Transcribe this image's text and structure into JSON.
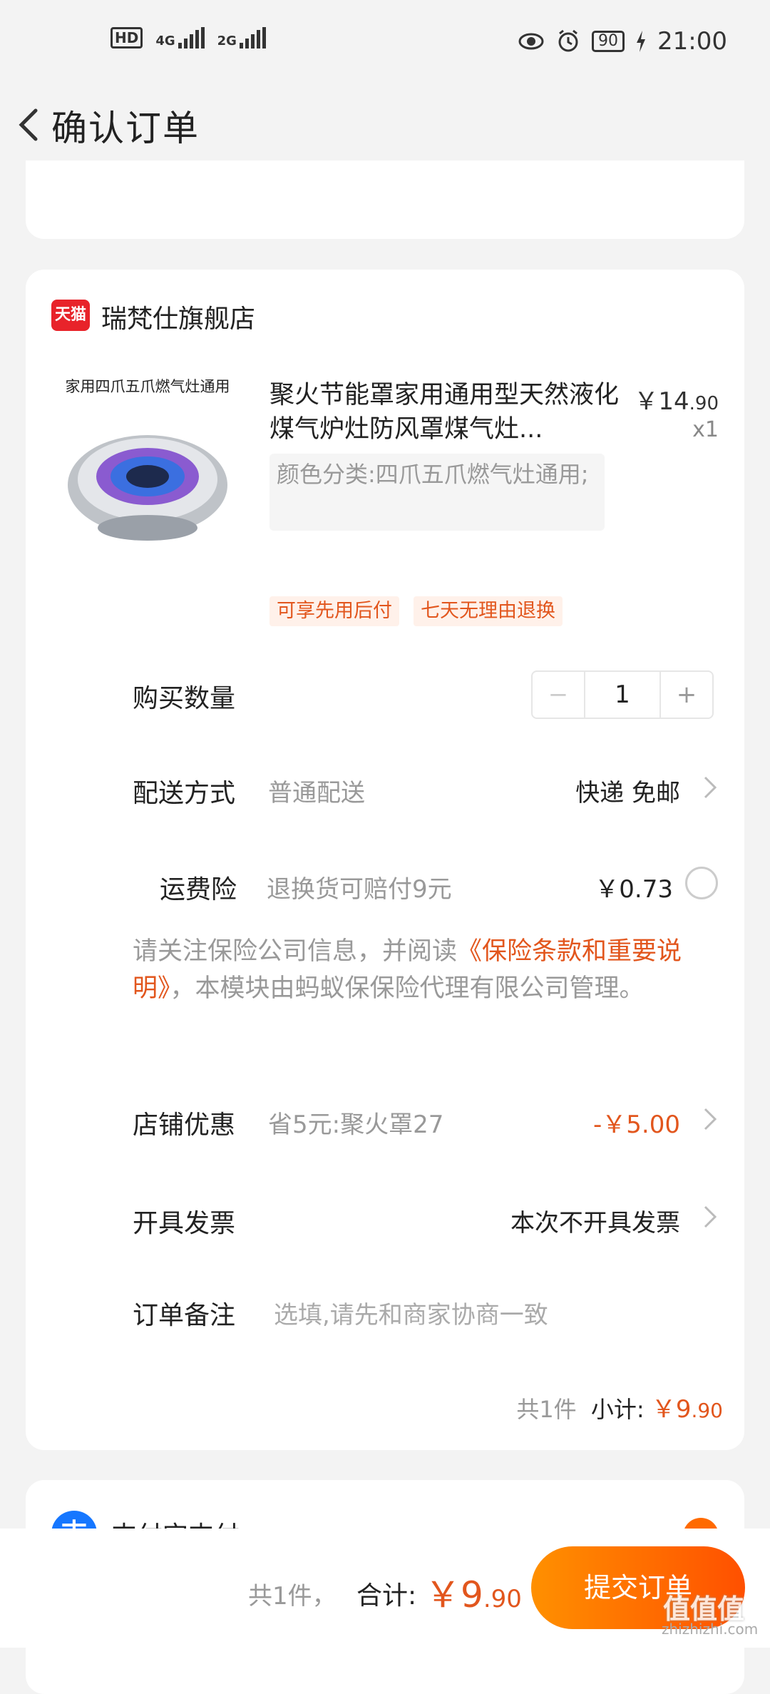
{
  "status_bar": {
    "hd": "HD",
    "sim1_net": "4G",
    "sim2_net": "2G",
    "battery": "90",
    "time": "21:00"
  },
  "header": {
    "title": "确认订单"
  },
  "shop": {
    "badge": "天猫",
    "name": "瑞梵仕旗舰店"
  },
  "product": {
    "image_caption": "家用四爪五爪燃气灶通用",
    "name": "聚火节能罩家用通用型天然液化煤气炉灶防风罩煤气灶...",
    "price_main": "￥14",
    "price_decimal": ".90",
    "quantity": "x1",
    "spec": "颜色分类:四爪五爪燃气灶通用;",
    "tags": [
      "可享先用后付",
      "七天无理由退换"
    ]
  },
  "rows": {
    "qty_label": "购买数量",
    "qty_value": "1",
    "minus": "−",
    "plus": "+",
    "delivery_label": "配送方式",
    "delivery_sub": "普通配送",
    "delivery_value": "快递 免邮",
    "insurance_label": "运费险",
    "insurance_sub": "退换货可赔付9元",
    "insurance_value": "￥0.73",
    "notice_before": "请关注保险公司信息，并阅读",
    "notice_link": "《保险条款和重要说明》",
    "notice_after": "，本模块由蚂蚁保保险代理有限公司管理。",
    "discount_label": "店铺优惠",
    "discount_sub": "省5元:聚火罩27",
    "discount_value": "-￥5.00",
    "invoice_label": "开具发票",
    "invoice_value": "本次不开具发票",
    "remark_label": "订单备注",
    "remark_placeholder": "选填,请先和商家协商一致"
  },
  "subtotal": {
    "count": "共1件",
    "label": "小计:",
    "amount_main": "￥9",
    "amount_decimal": ".90"
  },
  "payment": {
    "label": "支付宝支付"
  },
  "bottom": {
    "count": "共1件，",
    "total_label": "合计:",
    "total_main": "￥9",
    "total_decimal": ".90",
    "submit": "提交订单"
  },
  "watermark": {
    "logo": "值值值",
    "site": "zhizhizhi.com"
  },
  "colors": {
    "accent": "#e2561d",
    "submit_gradient_start": "#ff9000",
    "submit_gradient_end": "#ff5000",
    "tmall_red": "#e8232a"
  }
}
